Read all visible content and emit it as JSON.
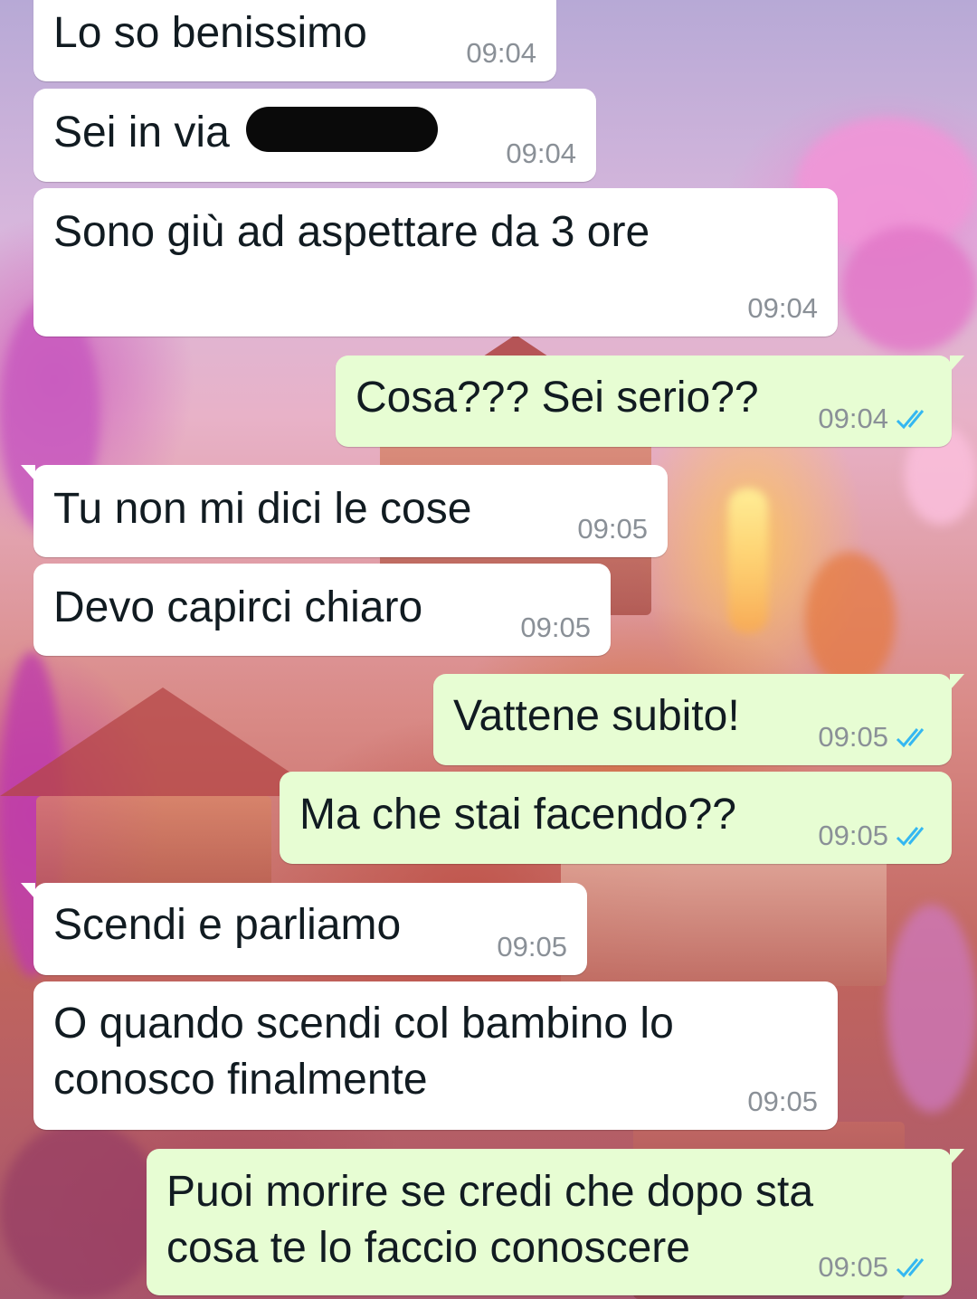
{
  "colors": {
    "incoming_bubble": "#ffffff",
    "outgoing_bubble": "#e7fdd3",
    "timestamp": "#8a9097",
    "read_receipt": "#34b7f1",
    "redaction": "#0a0a0a"
  },
  "messages": [
    {
      "direction": "incoming",
      "text": "Lo so benissimo",
      "time": "09:04"
    },
    {
      "direction": "incoming",
      "text": "Sei in via",
      "time": "09:04",
      "redacted": true
    },
    {
      "direction": "incoming",
      "text": "Sono giù ad aspettare da 3 ore",
      "time": "09:04"
    },
    {
      "direction": "outgoing",
      "text": "Cosa??? Sei serio??",
      "time": "09:04",
      "status_icon": "double-check-read-icon"
    },
    {
      "direction": "incoming",
      "text": "Tu non mi dici le cose",
      "time": "09:05"
    },
    {
      "direction": "incoming",
      "text": "Devo capirci chiaro",
      "time": "09:05"
    },
    {
      "direction": "outgoing",
      "text": "Vattene subito!",
      "time": "09:05",
      "status_icon": "double-check-read-icon"
    },
    {
      "direction": "outgoing",
      "text": "Ma che stai facendo??",
      "time": "09:05",
      "status_icon": "double-check-read-icon"
    },
    {
      "direction": "incoming",
      "text": "Scendi e parliamo",
      "time": "09:05"
    },
    {
      "direction": "incoming",
      "text": "O quando scendi col bambino lo\nconosco finalmente",
      "time": "09:05"
    },
    {
      "direction": "outgoing",
      "text": "Puoi morire se credi che dopo sta\ncosa te lo faccio conoscere",
      "time": "09:05",
      "status_icon": "double-check-read-icon"
    }
  ]
}
